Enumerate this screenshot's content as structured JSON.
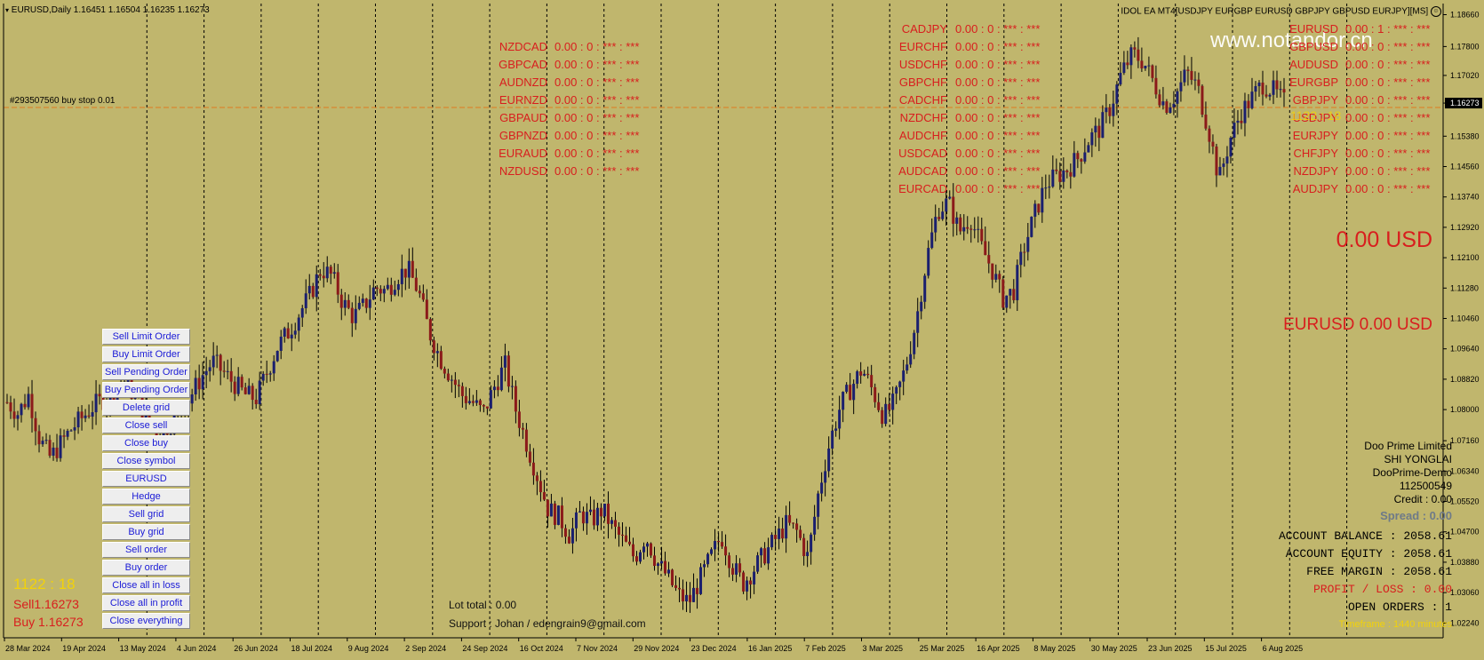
{
  "window": {
    "symbol_line": "EURUSD,Daily  1.16451 1.16504 1.16235 1.16273",
    "ea_title": "IDOL EA MT4[USDJPY EURGBP EURUSD GBPJPY GBPUSD EURJPY][MS]",
    "watermark": "www.notandor.cn",
    "order_line_label": "#293507560 buy stop 0.01",
    "current_price": "1.16273"
  },
  "colors": {
    "background": "#c0b66d",
    "bull": "#1a1f6e",
    "bear": "#8b1a1a",
    "pair_text": "#d81e1e",
    "button_text": "#1a1ad6"
  },
  "pairs": {
    "col1": [
      {
        "symbol": "NZDCAD",
        "value": "0.00 : 0 : *** : ***"
      },
      {
        "symbol": "GBPCAD",
        "value": "0.00 : 0 : *** : ***"
      },
      {
        "symbol": "AUDNZD",
        "value": "0.00 : 0 : *** : ***"
      },
      {
        "symbol": "EURNZD",
        "value": "0.00 : 0 : *** : ***"
      },
      {
        "symbol": "GBPAUD",
        "value": "0.00 : 0 : *** : ***"
      },
      {
        "symbol": "GBPNZD",
        "value": "0.00 : 0 : *** : ***"
      },
      {
        "symbol": "EURAUD",
        "value": "0.00 : 0 : *** : ***"
      },
      {
        "symbol": "NZDUSD",
        "value": "0.00 : 0 : *** : ***"
      }
    ],
    "col2": [
      {
        "symbol": "CADJPY",
        "value": "0.00 : 0 : *** : ***"
      },
      {
        "symbol": "EURCHF",
        "value": "0.00 : 0 : *** : ***"
      },
      {
        "symbol": "USDCHF",
        "value": "0.00 : 0 : *** : ***"
      },
      {
        "symbol": "GBPCHF",
        "value": "0.00 : 0 : *** : ***"
      },
      {
        "symbol": "CADCHF",
        "value": "0.00 : 0 : *** : ***"
      },
      {
        "symbol": "NZDCHF",
        "value": "0.00 : 0 : *** : ***"
      },
      {
        "symbol": "AUDCHF",
        "value": "0.00 : 0 : *** : ***"
      },
      {
        "symbol": "USDCAD",
        "value": "0.00 : 0 : *** : ***"
      },
      {
        "symbol": "AUDCAD",
        "value": "0.00 : 0 : *** : ***"
      },
      {
        "symbol": "EURCAD",
        "value": "0.00 : 0 : *** : ***"
      }
    ],
    "col3": [
      {
        "symbol": "EURUSD",
        "value": "0.00 : 1 : *** : ***"
      },
      {
        "symbol": "GBPUSD",
        "value": "0.00 : 0 : *** : ***"
      },
      {
        "symbol": "AUDUSD",
        "value": "0.00 : 0 : *** : ***"
      },
      {
        "symbol": "EURGBP",
        "value": "0.00 : 0 : *** : ***"
      },
      {
        "symbol": "GBPJPY",
        "value": "0.00 : 0 : *** : ***"
      },
      {
        "symbol": "USDJPY",
        "value": "0.00 : 0 : *** : ***"
      },
      {
        "symbol": "EURJPY",
        "value": "0.00 : 0 : *** : ***"
      },
      {
        "symbol": "CHFJPY",
        "value": "0.00 : 0 : *** : ***"
      },
      {
        "symbol": "NZDJPY",
        "value": "0.00 : 0 : *** : ***"
      },
      {
        "symbol": "AUDJPY",
        "value": "0.00 : 0 : *** : ***"
      }
    ],
    "yellow_overlay": "1122 : 18"
  },
  "totals": {
    "usd_total": "0.00 USD",
    "symbol_total": "EURUSD  0.00 USD"
  },
  "buttons": [
    "Sell Limit Order",
    "Buy Limit Order",
    "Sell Pending Order",
    "Buy Pending Order",
    "Delete grid",
    "Close sell",
    "Close buy",
    "Close symbol",
    "EURUSD",
    "Hedge",
    "Sell grid",
    "Buy grid",
    "Sell order",
    "Buy order",
    "Close all in loss",
    "Close all in profit",
    "Close everything"
  ],
  "left_info": {
    "timer": "1122 : 18",
    "sell": "Sell1.16273",
    "buy": "Buy 1.16273"
  },
  "footer": {
    "lot_total": "Lot total : 0.00",
    "support": "Support : Johan / edengrain9@gmail.com"
  },
  "account": {
    "broker": "Doo Prime Limited",
    "name": "SHI YONGLAI",
    "server": "DooPrime-Demo",
    "number": "112500549",
    "credit": "Credit : 0.00",
    "spread": "Spread : 0.00",
    "balance": "ACCOUNT BALANCE : 2058.61",
    "equity": "ACCOUNT EQUITY : 2058.61",
    "free_margin": "FREE MARGIN : 2058.61",
    "profit_loss": "PROFIT / LOSS : 0.00",
    "open_orders": "OPEN ORDERS : 1",
    "timeframe": "Timeframe : 1440 minutes"
  },
  "chart_data": {
    "type": "candlestick",
    "symbol": "EURUSD",
    "timeframe": "Daily",
    "y_ticks": [
      "1.18660",
      "1.17800",
      "1.17020",
      "1.16273",
      "1.15380",
      "1.14560",
      "1.13740",
      "1.12920",
      "1.12100",
      "1.11280",
      "1.10460",
      "1.09640",
      "1.08820",
      "1.08000",
      "1.07160",
      "1.06340",
      "1.05520",
      "1.04700",
      "1.03880",
      "1.03060",
      "1.02240"
    ],
    "ylim": [
      1.0184,
      1.1896
    ],
    "x_ticks": [
      "28 Mar 2024",
      "19 Apr 2024",
      "13 May 2024",
      "4 Jun 2024",
      "26 Jun 2024",
      "18 Jul 2024",
      "9 Aug 2024",
      "2 Sep 2024",
      "24 Sep 2024",
      "16 Oct 2024",
      "7 Nov 2024",
      "29 Nov 2024",
      "23 Dec 2024",
      "16 Jan 2025",
      "7 Feb 2025",
      "3 Mar 2025",
      "25 Mar 2025",
      "16 Apr 2025",
      "8 May 2025",
      "30 May 2025",
      "23 Jun 2025",
      "15 Jul 2025",
      "6 Aug 2025"
    ],
    "close_path": [
      1.082,
      1.079,
      1.084,
      1.072,
      1.067,
      1.071,
      1.075,
      1.078,
      1.081,
      1.083,
      1.086,
      1.088,
      1.082,
      1.077,
      1.074,
      1.076,
      1.079,
      1.084,
      1.089,
      1.093,
      1.09,
      1.087,
      1.084,
      1.083,
      1.09,
      1.097,
      1.101,
      1.106,
      1.111,
      1.118,
      1.116,
      1.109,
      1.105,
      1.108,
      1.113,
      1.112,
      1.116,
      1.118,
      1.112,
      1.101,
      1.094,
      1.089,
      1.084,
      1.082,
      1.079,
      1.086,
      1.092,
      1.08,
      1.071,
      1.062,
      1.053,
      1.051,
      1.046,
      1.052,
      1.05,
      1.053,
      1.048,
      1.044,
      1.04,
      1.046,
      1.039,
      1.035,
      1.03,
      1.028,
      1.034,
      1.04,
      1.046,
      1.038,
      1.033,
      1.037,
      1.041,
      1.045,
      1.049,
      1.047,
      1.04,
      1.058,
      1.071,
      1.081,
      1.086,
      1.091,
      1.085,
      1.078,
      1.082,
      1.091,
      1.104,
      1.121,
      1.134,
      1.136,
      1.128,
      1.132,
      1.124,
      1.118,
      1.11,
      1.112,
      1.124,
      1.133,
      1.141,
      1.143,
      1.145,
      1.148,
      1.153,
      1.156,
      1.162,
      1.171,
      1.176,
      1.174,
      1.168,
      1.162,
      1.165,
      1.171,
      1.167,
      1.156,
      1.142,
      1.153,
      1.16,
      1.164,
      1.168,
      1.166,
      1.163
    ]
  }
}
